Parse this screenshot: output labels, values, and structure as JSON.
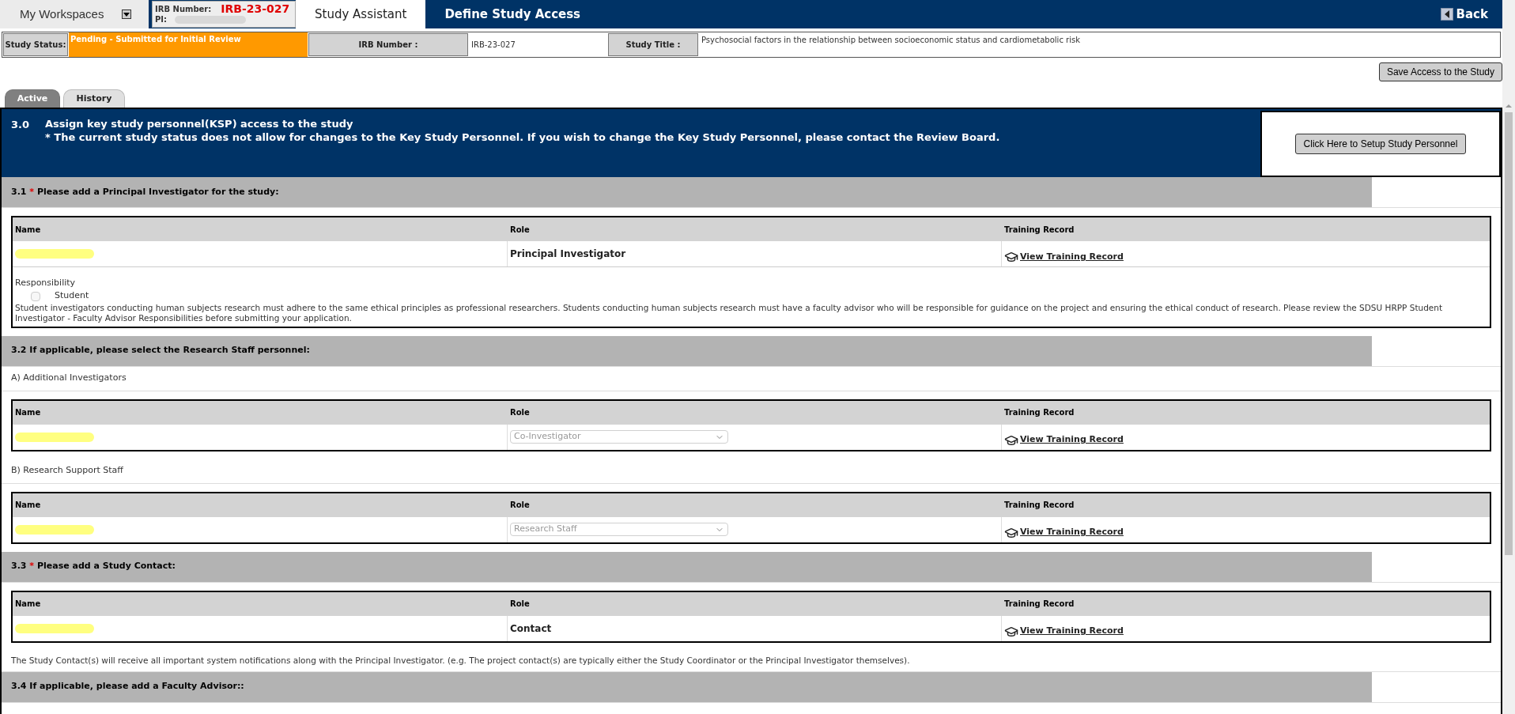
{
  "topbar": {
    "workspace_menu": "My Workspaces",
    "irb_label": "IRB Number:",
    "irb_number": "IRB-23-027",
    "pi_label": "PI:",
    "nav": [
      {
        "label": "Study Assistant",
        "selected": false
      },
      {
        "label": "Define Study Access",
        "selected": true
      }
    ],
    "back": "Back"
  },
  "study_info": [
    {
      "label": "Study Status:",
      "value": "Pending - Submitted for Initial Review",
      "kind": "status"
    },
    {
      "label": "IRB Number :",
      "value": "IRB-23-027",
      "kind": "plain"
    },
    {
      "label": "Study Title :",
      "value": "Psychosocial factors in the relationship between socioeconomic status and cardiometabolic risk",
      "kind": "plain"
    }
  ],
  "save_button": "Save Access to the Study",
  "tabs": [
    {
      "label": "Active",
      "selected": true
    },
    {
      "label": "History",
      "selected": false
    }
  ],
  "header": {
    "number": "3.0",
    "title": "Assign key study personnel(KSP) access to the study",
    "notice": "* The current study status does not allow for changes to the Key Study Personnel. If you wish to change the Key Study Personnel, please contact the Review Board.",
    "setup_button": "Click Here to Setup Study Personnel"
  },
  "sections": [
    {
      "number": "3.1",
      "required_mark": "*",
      "title": "Please add a Principal Investigator for the study:",
      "items": [
        {
          "kind": "table",
          "columns": [
            "Name",
            "Role",
            "Training Record"
          ],
          "rows": [
            {
              "role": "Principal Investigator",
              "kind": "text",
              "link": "View Training Record"
            }
          ],
          "responsibility": {
            "label": "Responsibility",
            "options": [
              {
                "label": "Student",
                "checked": false
              }
            ],
            "text": "Student investigators conducting human subjects research must adhere to the same ethical principles as professional researchers. Students conducting human subjects research must have a faculty advisor who will be responsible for guidance on the project and ensuring the ethical conduct of research. Please review the SDSU HRPP Student Investigator - Faculty Advisor Responsibilities before submitting your application."
          }
        }
      ]
    },
    {
      "number": "3.2",
      "title": "If applicable, please select the Research Staff personnel:",
      "items": [
        {
          "kind": "subheading",
          "text": "A) Additional Investigators"
        },
        {
          "kind": "table",
          "columns": [
            "Name",
            "Role",
            "Training Record"
          ],
          "rows": [
            {
              "role": "Co-Investigator",
              "kind": "select",
              "link": "View Training Record"
            }
          ]
        },
        {
          "kind": "subheading",
          "text": "B) Research Support Staff"
        },
        {
          "kind": "table",
          "columns": [
            "Name",
            "Role",
            "Training Record"
          ],
          "rows": [
            {
              "role": "Research Staff",
              "kind": "select",
              "link": "View Training Record"
            }
          ]
        }
      ]
    },
    {
      "number": "3.3",
      "required_mark": "*",
      "title": "Please add a Study Contact:",
      "items": [
        {
          "kind": "table",
          "columns": [
            "Name",
            "Role",
            "Training Record"
          ],
          "rows": [
            {
              "role": "Contact",
              "kind": "text",
              "link": "View Training Record"
            }
          ]
        },
        {
          "kind": "note",
          "text": "The Study Contact(s) will receive all important system notifications along with the Principal Investigator. (e.g. The project contact(s) are typically either the Study Coordinator or the Principal Investigator themselves)."
        }
      ]
    },
    {
      "number": "3.4",
      "title": "If applicable, please add a Faculty Advisor::"
    }
  ]
}
